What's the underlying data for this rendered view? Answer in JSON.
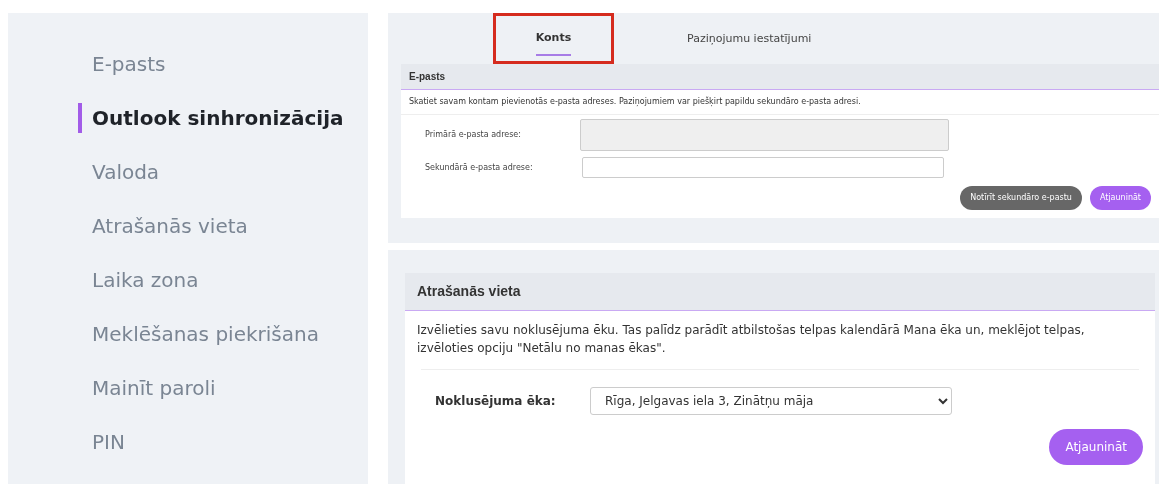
{
  "sidebar": {
    "items": [
      {
        "label": "E-pasts",
        "selected": false
      },
      {
        "label": "Outlook sinhronizācija",
        "selected": true
      },
      {
        "label": "Valoda",
        "selected": false
      },
      {
        "label": "Atrašanās vieta",
        "selected": false
      },
      {
        "label": "Laika zona",
        "selected": false
      },
      {
        "label": "Meklēšanas piekrišana",
        "selected": false
      },
      {
        "label": "Mainīt paroli",
        "selected": false
      },
      {
        "label": "PIN",
        "selected": false
      }
    ]
  },
  "tabs": [
    {
      "label": "Konts",
      "selected": true,
      "highlighted": true
    },
    {
      "label": "Paziņojumu iestatījumi",
      "selected": false,
      "highlighted": false
    }
  ],
  "email_card": {
    "title": "E-pasts",
    "description": "Skatiet savam kontam pievienotās e-pasta adreses. Paziņojumiem var piešķirt papildu sekundāro e-pasta adresi.",
    "fields": [
      {
        "label": "Primārā e-pasta adrese:",
        "disabled": true
      },
      {
        "label": "Sekundārā e-pasta adrese:",
        "disabled": false
      }
    ],
    "buttons": [
      {
        "label": "Notīrīt sekundāro e-pastu",
        "kind": "secondary"
      },
      {
        "label": "Atjaunināt",
        "kind": "primary"
      }
    ]
  },
  "location_card": {
    "title": "Atrašanās vieta",
    "description": "Izvēlieties savu noklusējuma ēku. Tas palīdz parādīt atbilstošas telpas kalendārā Mana ēka un, meklējot telpas, izvēloties opciju \"Netālu no manas ēkas\".",
    "field": {
      "label": "Noklusējuma ēka:",
      "value": "Rīga, Jelgavas iela 3, Zinātņu māja"
    },
    "button": {
      "label": "Atjaunināt",
      "kind": "primary"
    }
  }
}
